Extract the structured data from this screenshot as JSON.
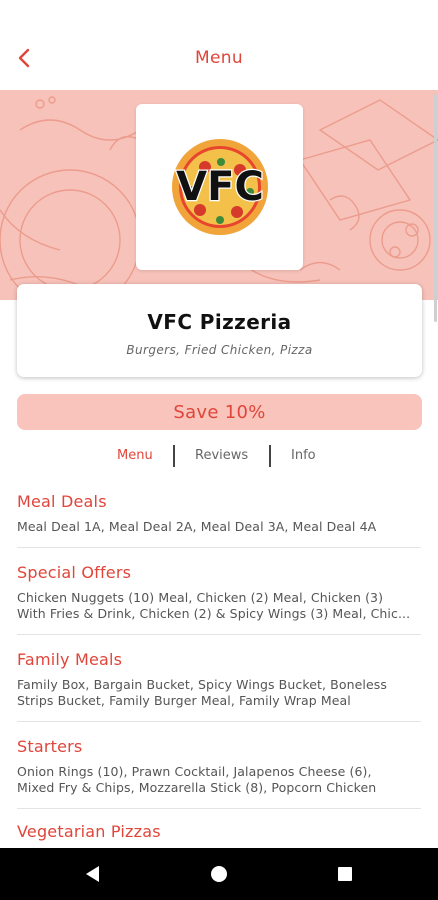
{
  "header": {
    "title": "Menu",
    "back_icon": "chevron-left-icon"
  },
  "restaurant": {
    "logo_text": "VFC",
    "name": "VFC Pizzeria",
    "cuisines": "Burgers, Fried Chicken, Pizza"
  },
  "promo": {
    "label": "Save 10%"
  },
  "tabs": [
    {
      "label": "Menu",
      "active": true
    },
    {
      "label": "Reviews",
      "active": false
    },
    {
      "label": "Info",
      "active": false
    }
  ],
  "categories": [
    {
      "title": "Meal Deals",
      "line1": "Meal Deal 1A, Meal Deal 2A, Meal Deal 3A, Meal Deal 4A",
      "line2": ""
    },
    {
      "title": "Special Offers",
      "line1": "Chicken Nuggets (10) Meal, Chicken (2) Meal, Chicken (3)",
      "line2": "With Fries & Drink, Chicken (2) & Spicy Wings (3) Meal, Chic..."
    },
    {
      "title": "Family Meals",
      "line1": "Family Box, Bargain Bucket, Spicy Wings Bucket, Boneless",
      "line2": "Strips Bucket, Family Burger Meal, Family Wrap Meal"
    },
    {
      "title": "Starters",
      "line1": "Onion Rings (10), Prawn Cocktail, Jalapenos Cheese (6),",
      "line2": "Mixed Fry & Chips, Mozzarella Stick (8), Popcorn Chicken"
    },
    {
      "title": "Vegetarian Pizzas",
      "line1": "",
      "line2": ""
    }
  ],
  "colors": {
    "accent": "#e0453a",
    "banner_bg": "#f7c2b9",
    "promo_bg": "#f8c4bb"
  },
  "navbar": {
    "icons": [
      "back-triangle-icon",
      "home-circle-icon",
      "recents-square-icon"
    ]
  }
}
